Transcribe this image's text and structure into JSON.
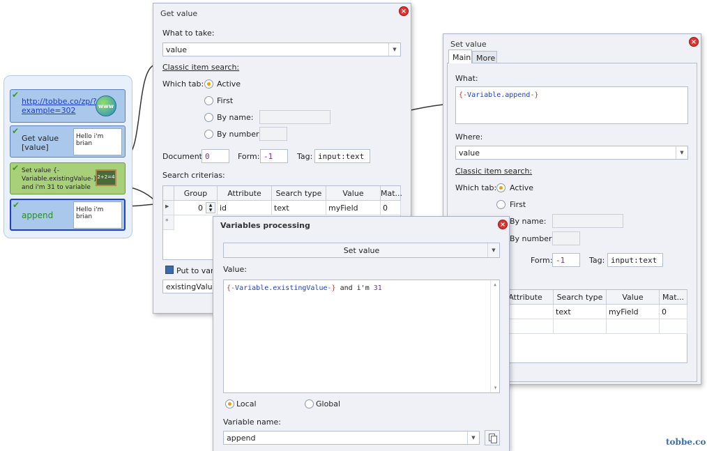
{
  "workflow": {
    "node1": {
      "link": "http://tobbe.co/zp/?example=302",
      "link_line1": "http://tobbe.co/zp/?",
      "link_line2": "example=302"
    },
    "node2": {
      "title_line1": "Get value",
      "title_line2": "[value]",
      "preview": "Hello i'm brian"
    },
    "node3": {
      "title_line1": "Set value {-",
      "title_line2": "Variable.existingValue-}",
      "title_line3": "and i'm 31 to variable"
    },
    "node4": {
      "title": "append",
      "preview": "Hello i'm brian"
    }
  },
  "get_value": {
    "title": "Get value",
    "what_to_take_label": "What to take:",
    "what_to_take_value": "value",
    "classic_search_label": "Classic item search:",
    "which_tab_label": "Which tab:",
    "tab_options": [
      "Active",
      "First",
      "By name:",
      "By number:"
    ],
    "document_label": "Document:",
    "document_value": "0",
    "form_label": "Form:",
    "form_value": "-1",
    "tag_label": "Tag:",
    "tag_value": "input:text",
    "search_criterias_label": "Search criterias:",
    "grid_headers": [
      "Group",
      "Attribute",
      "Search type",
      "Value",
      "Mat..."
    ],
    "grid_row": {
      "group": "0",
      "attribute": "id",
      "search_type": "text",
      "value": "myField",
      "match": "0"
    },
    "new_row_marker": "*",
    "put_to_var_label": "Put to varia",
    "existing_value": "existingValue"
  },
  "set_value": {
    "title": "Set value",
    "tabs": [
      "Main",
      "More"
    ],
    "what_label": "What:",
    "what_value": "{-Variable.append-}",
    "where_label": "Where:",
    "where_value": "value",
    "classic_search_label": "Classic item search:",
    "which_tab_label": "Which tab:",
    "tab_options": [
      "Active",
      "First",
      "By name:",
      "By number:"
    ],
    "form_label": "Form:",
    "form_value": "-1",
    "tag_label": "Tag:",
    "tag_value": "input:text",
    "grid_headers": [
      "Attribute",
      "Search type",
      "Value",
      "Mat..."
    ],
    "grid_row": {
      "search_type": "text",
      "value": "myField",
      "match": "0"
    }
  },
  "variables_processing": {
    "title": "Variables processing",
    "action_value": "Set value",
    "value_label": "Value:",
    "value_text": "{-Variable.existingValue-} and i'm 31",
    "scope_options": [
      "Local",
      "Global"
    ],
    "variable_name_label": "Variable name:",
    "variable_name_value": "append"
  },
  "watermark": "tobbe.co",
  "colors": {
    "accent_orange": "#f0a000",
    "node_blue": "#a9c8ec",
    "node_green": "#a8d07a",
    "variable_purple": "#7a2aa8"
  }
}
